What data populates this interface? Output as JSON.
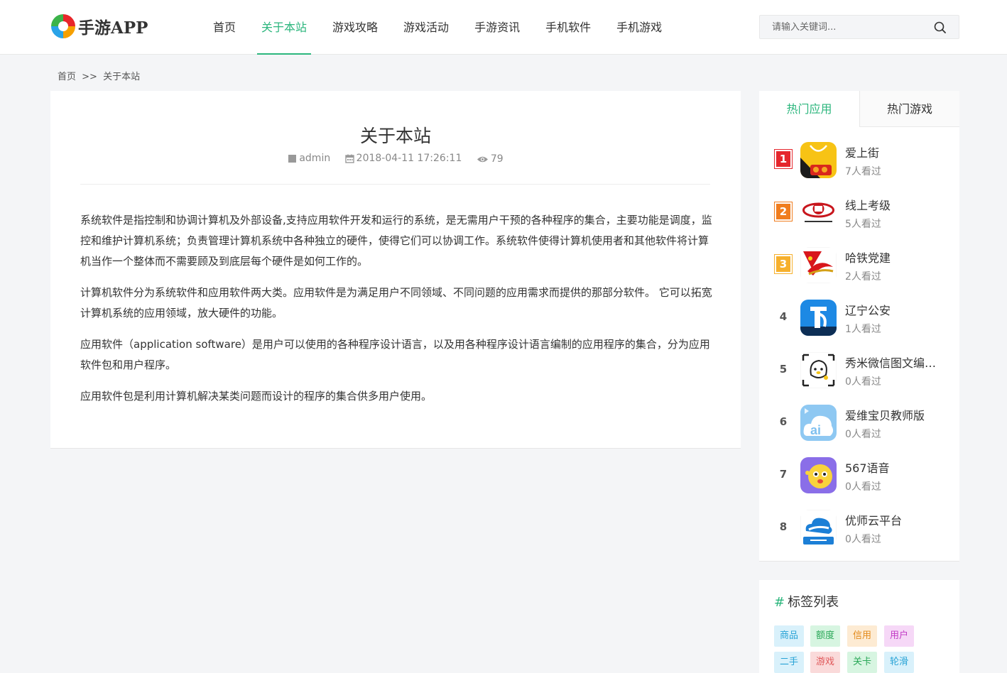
{
  "logo": {
    "text": "手游APP"
  },
  "nav": {
    "items": [
      {
        "label": "首页"
      },
      {
        "label": "关于本站"
      },
      {
        "label": "游戏攻略"
      },
      {
        "label": "游戏活动"
      },
      {
        "label": "手游资讯"
      },
      {
        "label": "手机软件"
      },
      {
        "label": "手机游戏"
      }
    ],
    "active_label": "关于本站"
  },
  "search": {
    "placeholder": "请输入关键词...",
    "value": ""
  },
  "breadcrumb": {
    "home": "首页",
    "separator": ">>",
    "current": "关于本站"
  },
  "article": {
    "title": "关于本站",
    "author": "admin",
    "datetime": "2018-04-11 17:26:11",
    "views": "79",
    "paragraphs": [
      "系统软件是指控制和协调计算机及外部设备,支持应用软件开发和运行的系统，是无需用户干预的各种程序的集合，主要功能是调度，监控和维护计算机系统；负责管理计算机系统中各种独立的硬件，使得它们可以协调工作。系统软件使得计算机使用者和其他软件将计算机当作一个整体而不需要顾及到底层每个硬件是如何工作的。",
      "计算机软件分为系统软件和应用软件两大类。应用软件是为满足用户不同领域、不同问题的应用需求而提供的那部分软件。 它可以拓宽计算机系统的应用领域，放大硬件的功能。",
      "应用软件（application software）是用户可以使用的各种程序设计语言，以及用各种程序设计语言编制的应用程序的集合，分为应用软件包和用户程序。",
      "应用软件包是利用计算机解决某类问题而设计的程序的集合供多用户使用。"
    ]
  },
  "sidebar": {
    "tabs": [
      {
        "label": "热门应用"
      },
      {
        "label": "热门游戏"
      }
    ],
    "active_tab": "热门应用",
    "hot_apps": [
      {
        "rank": "1",
        "name": "爱上街",
        "views": "7人看过",
        "icon": "shopping-bag-app-icon"
      },
      {
        "rank": "2",
        "name": "线上考级",
        "views": "5人看过",
        "icon": "exam-emblem-app-icon"
      },
      {
        "rank": "3",
        "name": "哈铁党建",
        "views": "2人看过",
        "icon": "party-railway-app-icon"
      },
      {
        "rank": "4",
        "name": "辽宁公安",
        "views": "1人看过",
        "icon": "police-app-icon"
      },
      {
        "rank": "5",
        "name": "秀米微信图文编辑器",
        "views": "0人看过",
        "icon": "xiumi-mascot-app-icon"
      },
      {
        "rank": "6",
        "name": "爱维宝贝教师版",
        "views": "0人看过",
        "icon": "cloud-ai-app-icon"
      },
      {
        "rank": "7",
        "name": "567语音",
        "views": "0人看过",
        "icon": "voice-mascot-app-icon"
      },
      {
        "rank": "8",
        "name": "优师云平台",
        "views": "0人看过",
        "icon": "youshi-cloud-app-icon"
      }
    ]
  },
  "tags": {
    "title": "标签列表",
    "items": [
      {
        "label": "商品",
        "color": "#29a3d6",
        "bg": "#d9f1fb"
      },
      {
        "label": "额度",
        "color": "#2aa858",
        "bg": "#d7f5e1"
      },
      {
        "label": "信用",
        "color": "#e38a1b",
        "bg": "#fdebd3"
      },
      {
        "label": "用户",
        "color": "#c23bc6",
        "bg": "#f6d8f7"
      },
      {
        "label": "二手",
        "color": "#29a3d6",
        "bg": "#d9f1fb"
      },
      {
        "label": "游戏",
        "color": "#e0585a",
        "bg": "#fadada"
      },
      {
        "label": "关卡",
        "color": "#2aa858",
        "bg": "#d7f5e1"
      },
      {
        "label": "轮滑",
        "color": "#29a3d6",
        "bg": "#d9f1fb"
      }
    ]
  },
  "colors": {
    "accent": "#2cb67d",
    "rank1": "#e5272d",
    "rank2": "#f07d1e",
    "rank3": "#f6b02d"
  }
}
